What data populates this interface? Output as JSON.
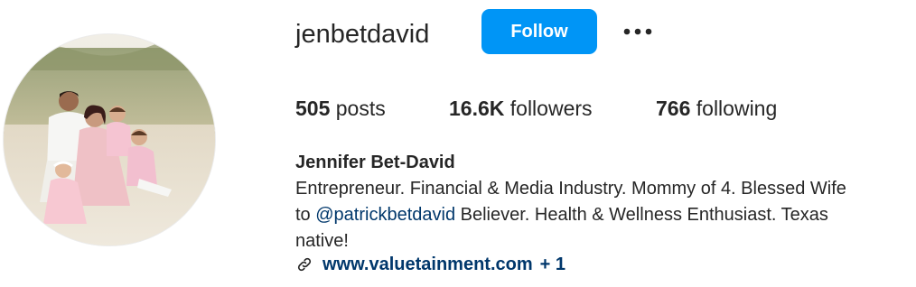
{
  "profile": {
    "username": "jenbetdavid",
    "follow_label": "Follow",
    "more_options": "more-options-icon",
    "avatar_alt": "profile-picture"
  },
  "stats": {
    "posts_count": "505",
    "posts_label": "posts",
    "followers_count": "16.6K",
    "followers_label": "followers",
    "following_count": "766",
    "following_label": "following"
  },
  "bio": {
    "full_name": "Jennifer Bet-David",
    "line1": "Entrepreneur. Financial & Media Industry. Mommy of 4. Blessed Wife",
    "line2_prefix": "to ",
    "mention": "@patrickbetdavid",
    "line2_suffix": " Believer. Health & Wellness Enthusiast. Texas",
    "line3": "native!",
    "link_icon": "link-icon",
    "link_text": "www.valuetainment.com",
    "link_extra": "+ 1"
  },
  "colors": {
    "primary_button": "#0095f6",
    "text": "#262626",
    "link": "#00376b"
  }
}
